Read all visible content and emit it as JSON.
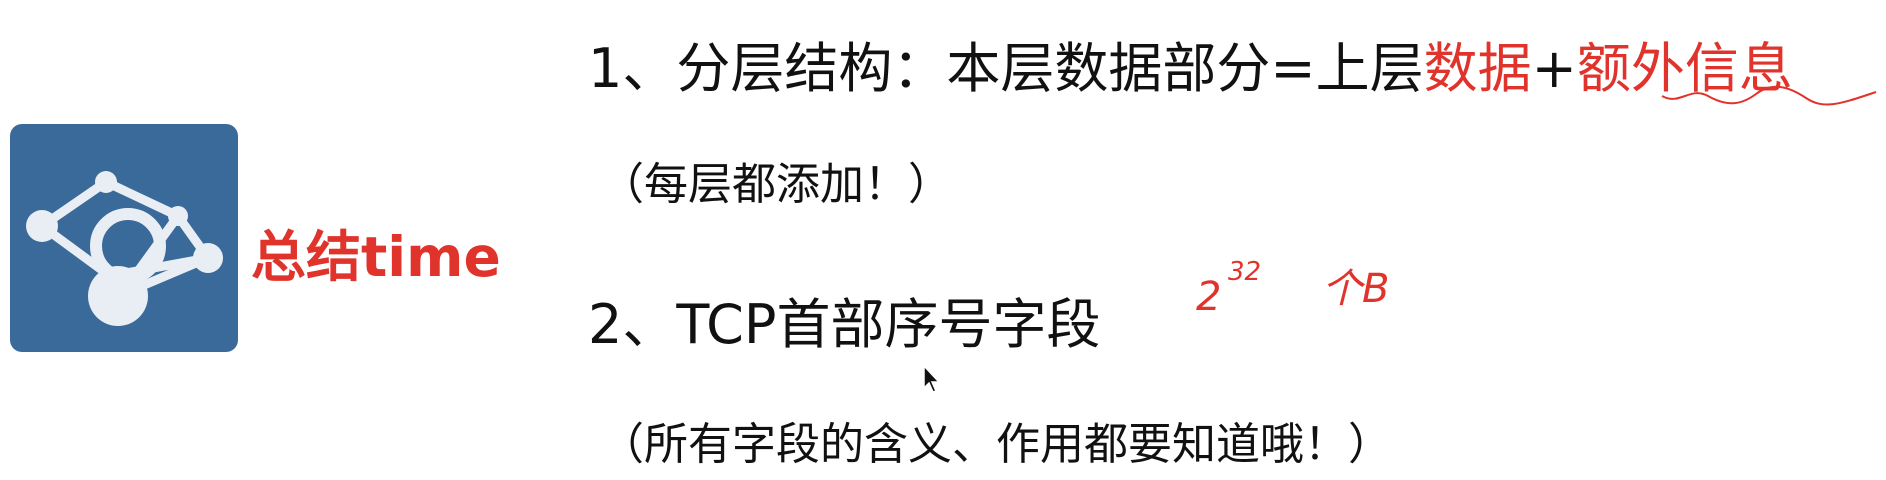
{
  "sidebar": {
    "logo_icon": "network-graph-icon",
    "title": "总结time"
  },
  "points": [
    {
      "number": "1、",
      "heading_prefix": "分层结构：本层数据部分=上层",
      "highlight1": "数据",
      "plus": "+",
      "highlight2": "额外信息",
      "note": "（每层都添加！）"
    },
    {
      "number": "2、",
      "heading": "TCP首部序号字段",
      "note": "（所有字段的含义、作用都要知道哦！）"
    }
  ],
  "handwritten_annotation": {
    "base": "2",
    "exponent": "32",
    "unit": "个B"
  },
  "colors": {
    "logo_bg": "#3a6a9a",
    "accent": "#e0332b"
  }
}
